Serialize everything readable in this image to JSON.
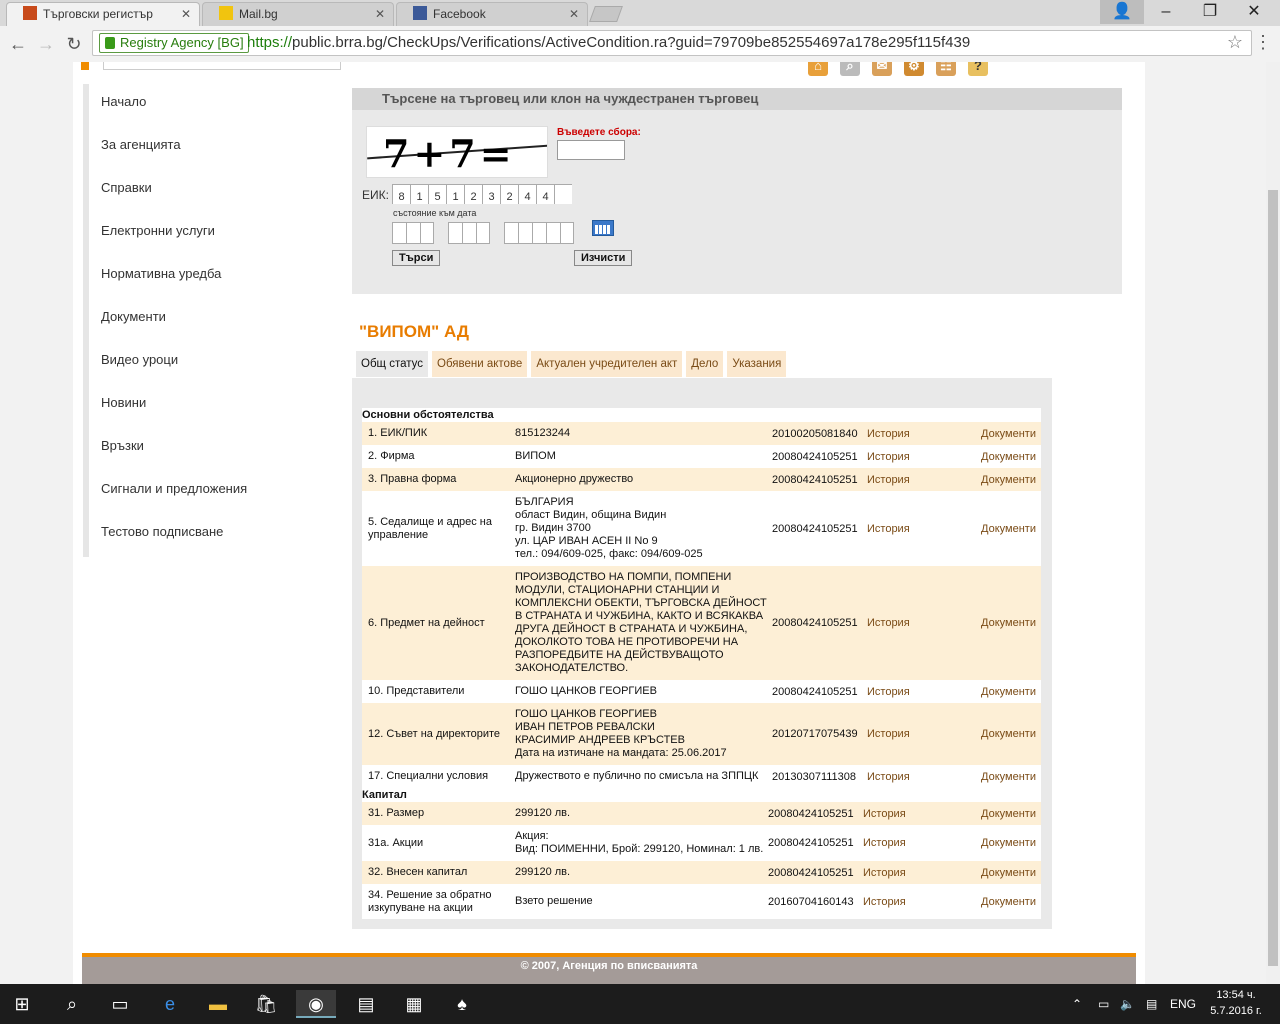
{
  "browser": {
    "tabs": [
      {
        "title": "Търговски регистър",
        "active": true
      },
      {
        "title": "Mail.bg",
        "active": false
      },
      {
        "title": "Facebook",
        "active": false
      }
    ],
    "secure_label": "Registry Agency [BG]",
    "url_scheme": "https://",
    "url_rest": "public.brra.bg/CheckUps/Verifications/ActiveCondition.ra?guid=79709be852554697a178e295f115f439"
  },
  "sidebar": {
    "items": [
      {
        "label": "Начало"
      },
      {
        "label": "За агенцията"
      },
      {
        "label": "Справки"
      },
      {
        "label": "Електронни услуги"
      },
      {
        "label": "Нормативна уредба"
      },
      {
        "label": "Документи"
      },
      {
        "label": "Видео уроци"
      },
      {
        "label": "Новини"
      },
      {
        "label": "Връзки"
      },
      {
        "label": "Сигнали и предложения"
      },
      {
        "label": "Тестово подписване"
      }
    ]
  },
  "search": {
    "heading": "Търсене на търговец или клон на чуждестранен търговец",
    "captcha_text": "7+7=",
    "captcha_label": "Въведете сбора:",
    "eik_label": "ЕИК:",
    "eik_digits": [
      "8",
      "1",
      "5",
      "1",
      "2",
      "3",
      "2",
      "4",
      "4",
      ""
    ],
    "date_label": "състояние към дата",
    "search_button": "Търси",
    "clear_button": "Изчисти"
  },
  "company": {
    "name": "\"ВИПОМ\" АД",
    "tabs": [
      {
        "label": "Общ статус",
        "active": true
      },
      {
        "label": "Обявени актове",
        "active": false
      },
      {
        "label": "Актуален учредителен акт",
        "active": false
      },
      {
        "label": "Дело",
        "active": false
      },
      {
        "label": "Указания",
        "active": false
      }
    ]
  },
  "table": {
    "history_label": "История",
    "docs_label": "Документи",
    "section_main": "Основни обстоятелства",
    "section_capital": "Капитал",
    "main_rows": [
      {
        "label": "1.  ЕИК/ПИК",
        "value": "815123244",
        "date": "20100205081840"
      },
      {
        "label": "2.  Фирма",
        "value": "ВИПОМ",
        "date": "20080424105251"
      },
      {
        "label": "3.  Правна форма",
        "value": "Акционерно дружество",
        "date": "20080424105251"
      },
      {
        "label": "5.  Седалище и адрес на управление",
        "value": "БЪЛГАРИЯ\nобласт Видин, община Видин\nгр. Видин 3700\nул. ЦАР ИВАН АСЕН II No 9\nтел.: 094/609-025, факс: 094/609-025",
        "date": "20080424105251"
      },
      {
        "label": "6.  Предмет на дейност",
        "value": "ПРОИЗВОДСТВО НА ПОМПИ, ПОМПЕНИ МОДУЛИ, СТАЦИОНАРНИ СТАНЦИИ И КОМПЛЕКСНИ ОБЕКТИ, ТЪРГОВСКА ДЕЙНОСТ В СТРАНАТА И ЧУЖБИНА, КАКТО И ВСЯКАКВА ДРУГА ДЕЙНОСТ В СТРАНАТА И ЧУЖБИНА, ДОКОЛКОТО ТОВА НЕ ПРОТИВОРЕЧИ НА РАЗПОРЕДБИТЕ НА ДЕЙСТВУВАЩОТО ЗАКОНОДАТЕЛСТВО.",
        "date": "20080424105251"
      },
      {
        "label": "10.  Представители",
        "value": "ГОШО ЦАНКОВ ГЕОРГИЕВ",
        "date": "20080424105251"
      },
      {
        "label": "12.  Съвет на директорите",
        "value": "ГОШО ЦАНКОВ ГЕОРГИЕВ\nИВАН ПЕТРОВ РЕВАЛСКИ\nКРАСИМИР АНДРЕЕВ КРЪСТЕВ\nДата на изтичане на мандата: 25.06.2017",
        "date": "20120717075439"
      },
      {
        "label": "17.  Специални условия",
        "value": "Дружеството е публично по смисъла на ЗППЦК",
        "date": "20130307111308"
      }
    ],
    "capital_rows": [
      {
        "label": "31.  Размер",
        "value": "299120 лв.",
        "date": "20080424105251"
      },
      {
        "label": "31а.  Акции",
        "value": "Акция:\nВид: ПОИМЕННИ, Брой: 299120, Номинал: 1 лв.",
        "date": "20080424105251"
      },
      {
        "label": "32.  Внесен капитал",
        "value": "299120 лв.",
        "date": "20080424105251"
      },
      {
        "label": "34.  Решение за обратно изкупуване на акции",
        "value": "Взето решение",
        "date": "20160704160143"
      }
    ]
  },
  "footer": {
    "text": "© 2007, Агенция по вписванията"
  },
  "taskbar": {
    "lang": "ENG",
    "time": "13:54 ч.",
    "date": "5.7.2016 г."
  }
}
